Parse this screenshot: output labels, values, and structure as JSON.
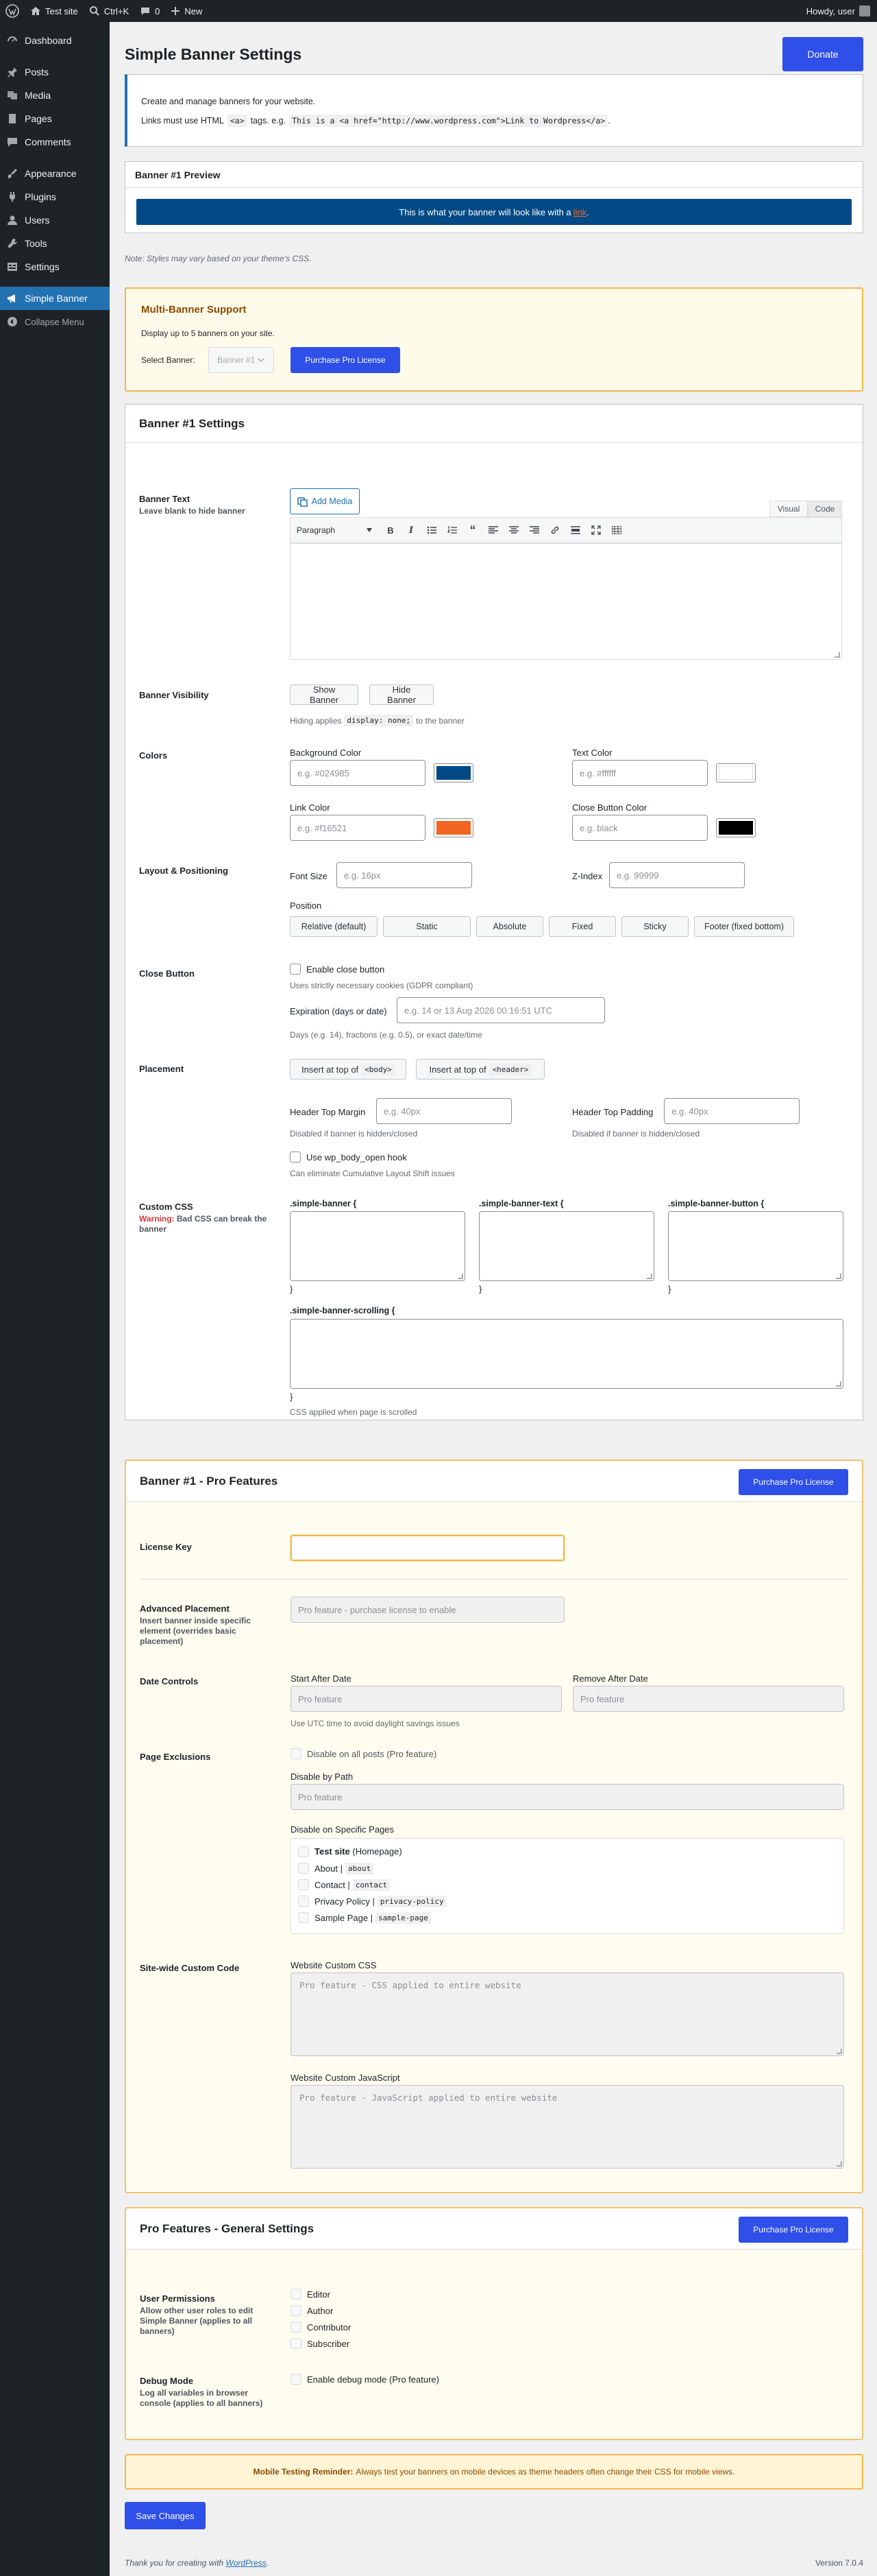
{
  "adminbar": {
    "site": "Test site",
    "shortcut": "Ctrl+K",
    "comments": "0",
    "new": "New",
    "howdy": "Howdy, user"
  },
  "sidebar": {
    "items": [
      {
        "label": "Dashboard",
        "icon": "dashboard-icon"
      },
      {
        "label": "Posts",
        "icon": "pin-icon"
      },
      {
        "label": "Media",
        "icon": "media-icon"
      },
      {
        "label": "Pages",
        "icon": "page-icon"
      },
      {
        "label": "Comments",
        "icon": "comment-icon"
      },
      {
        "label": "Appearance",
        "icon": "brush-icon"
      },
      {
        "label": "Plugins",
        "icon": "plug-icon"
      },
      {
        "label": "Users",
        "icon": "user-icon"
      },
      {
        "label": "Tools",
        "icon": "wrench-icon"
      },
      {
        "label": "Settings",
        "icon": "settings-icon"
      },
      {
        "label": "Simple Banner",
        "icon": "megaphone-icon"
      }
    ],
    "collapse": "Collapse Menu"
  },
  "header": {
    "title": "Simple Banner Settings",
    "donate": "Donate"
  },
  "intro": {
    "line1": "Create and manage banners for your website.",
    "line2a": "Links must use HTML",
    "code1": "<a>",
    "line2b": "tags. e.g.",
    "code2": "This is a <a href=\"http://www.wordpress.com\">Link to Wordpress</a>",
    "period": "."
  },
  "preview": {
    "title": "Banner #1 Preview",
    "text": "This is what your banner will look like with a",
    "link": "link",
    "dot": ".",
    "note": "Note: Styles may vary based on your theme's CSS."
  },
  "multi": {
    "title": "Multi-Banner Support",
    "desc": "Display up to 5 banners on your site.",
    "select_label": "Select Banner:",
    "select_value": "Banner #1",
    "button": "Purchase Pro License"
  },
  "settings": {
    "title": "Banner #1 Settings",
    "banner_text": {
      "label": "Banner Text",
      "sub": "Leave blank to hide banner",
      "add_media": "Add Media",
      "tab_visual": "Visual",
      "tab_code": "Code",
      "paragraph": "Paragraph"
    },
    "visibility": {
      "label": "Banner Visibility",
      "show": "Show Banner",
      "hide": "Hide Banner",
      "help_a": "Hiding applies",
      "help_code": "display: none;",
      "help_b": "to the banner"
    },
    "colors": {
      "label": "Colors",
      "bg_label": "Background Color",
      "bg_ph": "e.g. #024985",
      "bg_color": "#024985",
      "text_label": "Text Color",
      "text_ph": "e.g. #ffffff",
      "text_color": "#ffffff",
      "link_label": "Link Color",
      "link_ph": "e.g. #f16521",
      "link_color": "#f16521",
      "close_label": "Close Button Color",
      "close_ph": "e.g. black",
      "close_color": "#000000"
    },
    "layout": {
      "label": "Layout & Positioning",
      "font_label": "Font Size",
      "font_ph": "e.g. 16px",
      "z_label": "Z-Index",
      "z_ph": "e.g. 99999",
      "position_label": "Position",
      "positions": [
        "Relative (default)",
        "Static",
        "Absolute",
        "Fixed",
        "Sticky",
        "Footer (fixed bottom)"
      ]
    },
    "close": {
      "label": "Close Button",
      "enable": "Enable close button",
      "help1": "Uses strictly necessary cookies (GDPR compliant)",
      "exp_label": "Expiration (days or date)",
      "exp_ph": "e.g. 14 or 13 Aug 2026 00:16:51 UTC",
      "help2": "Days (e.g. 14), fractions (e.g. 0.5), or exact date/time"
    },
    "placement": {
      "label": "Placement",
      "btn1a": "Insert at top of",
      "btn1code": "<body>",
      "btn2a": "Insert at top of",
      "btn2code": "<header>",
      "margin_label": "Header Top Margin",
      "margin_ph": "e.g. 40px",
      "margin_help": "Disabled if banner is hidden/closed",
      "padding_label": "Header Top Padding",
      "padding_ph": "e.g. 40px",
      "padding_help": "Disabled if banner is hidden/closed",
      "hook": "Use wp_body_open hook",
      "hook_help": "Can eliminate Cumulative Layout Shift issues"
    },
    "css": {
      "label": "Custom CSS",
      "warn_a": "Warning:",
      "warn_b": "Bad CSS can break the banner",
      "sel1": ".simple-banner {",
      "sel2": ".simple-banner-text {",
      "sel3": ".simple-banner-button {",
      "sel4": ".simple-banner-scrolling {",
      "close_brace": "}",
      "help": "CSS applied when page is scrolled"
    }
  },
  "pro": {
    "title": "Banner #1 - Pro Features",
    "button": "Purchase Pro License",
    "license_label": "License Key",
    "adv_label": "Advanced Placement",
    "adv_sub": "Insert banner inside specific element (overrides basic placement)",
    "adv_ph": "Pro feature - purchase license to enable",
    "date_label": "Date Controls",
    "start_label": "Start After Date",
    "start_ph": "Pro feature",
    "remove_label": "Remove After Date",
    "remove_ph": "Pro feature",
    "date_help": "Use UTC time to avoid daylight savings issues",
    "excl_label": "Page Exclusions",
    "disable_posts": "Disable on all posts (Pro feature)",
    "path_label": "Disable by Path",
    "path_ph": "Pro feature",
    "specific_label": "Disable on Specific Pages",
    "pages": [
      {
        "name": "Test site",
        "suffix": "(Homepage)",
        "slug": ""
      },
      {
        "name": "About |",
        "suffix": "",
        "slug": "about"
      },
      {
        "name": "Contact |",
        "suffix": "",
        "slug": "contact"
      },
      {
        "name": "Privacy Policy |",
        "suffix": "",
        "slug": "privacy-policy"
      },
      {
        "name": "Sample Page |",
        "suffix": "",
        "slug": "sample-page"
      }
    ],
    "site_label": "Site-wide Custom Code",
    "site_css_label": "Website Custom CSS",
    "site_css_ph": "Pro feature - CSS applied to entire website",
    "site_js_label": "Website Custom JavaScript",
    "site_js_ph": "Pro feature - JavaScript applied to entire website"
  },
  "general": {
    "title": "Pro Features - General Settings",
    "button": "Purchase Pro License",
    "perm_label": "User Permissions",
    "perm_sub": "Allow other user roles to edit Simple Banner (applies to all banners)",
    "roles": [
      "Editor",
      "Author",
      "Contributor",
      "Subscriber"
    ],
    "debug_label": "Debug Mode",
    "debug_sub": "Log all variables in browser console (applies to all banners)",
    "debug_opt": "Enable debug mode (Pro feature)"
  },
  "mobile": {
    "bold": "Mobile Testing Reminder:",
    "text": "Always test your banners on mobile devices as theme headers often change their CSS for mobile views."
  },
  "save": "Save Changes",
  "footer": {
    "thanks": "Thank you for creating with",
    "wp": "WordPress",
    "dot": ".",
    "version": "Version 7.0.4"
  }
}
